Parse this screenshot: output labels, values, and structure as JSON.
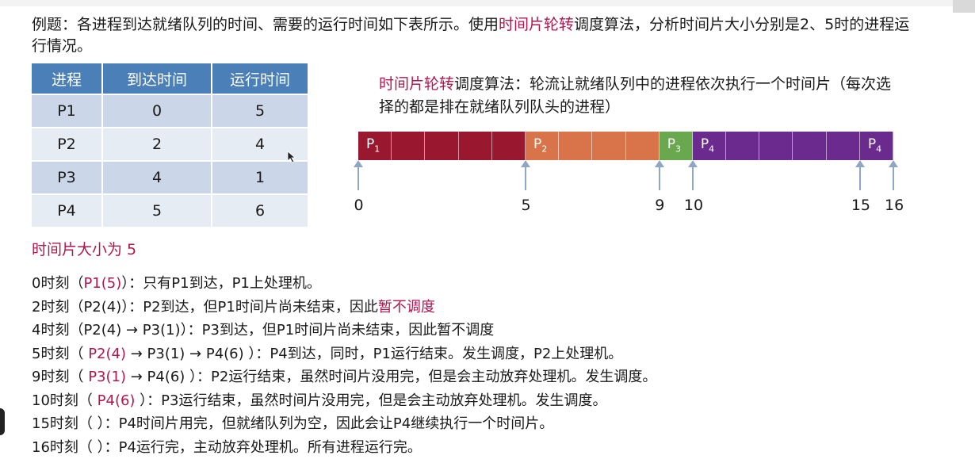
{
  "intro": {
    "part1": "例题：各进程到达就绪队列的时间、需要的运行时间如下表所示。使用",
    "highlight": "时间片轮转",
    "part2": "调度算法，分析时间片大小分别是2、5时的进程运行情况。"
  },
  "table": {
    "headers": [
      "进程",
      "到达时间",
      "运行时间"
    ],
    "rows": [
      [
        "P1",
        "0",
        "5"
      ],
      [
        "P2",
        "2",
        "4"
      ],
      [
        "P3",
        "4",
        "1"
      ],
      [
        "P4",
        "5",
        "6"
      ]
    ]
  },
  "rr_desc": {
    "highlight": "时间片轮转",
    "text": "调度算法：轮流让就绪队列中的进程依次执行一个时间片（每次选择的都是排在就绪队列队头的进程）"
  },
  "gantt": {
    "colors": {
      "P1": "#9a1730",
      "P2": "#d9744a",
      "P3": "#6aa84f",
      "P4": "#6a2a8e"
    },
    "segments": [
      {
        "label": "P",
        "sub": "1",
        "process": "P1",
        "start": 0,
        "end": 5
      },
      {
        "label": "P",
        "sub": "2",
        "process": "P2",
        "start": 5,
        "end": 9
      },
      {
        "label": "P",
        "sub": "3",
        "process": "P3",
        "start": 9,
        "end": 10
      },
      {
        "label": "P",
        "sub": "4",
        "process": "P4",
        "start": 10,
        "end": 15
      },
      {
        "label": "P",
        "sub": "4",
        "process": "P4",
        "start": 15,
        "end": 16
      }
    ],
    "ticks": [
      "0",
      "5",
      "9",
      "10",
      "15",
      "16"
    ]
  },
  "time_slice": "时间片大小为 5",
  "logs": [
    [
      {
        "t": "0时刻（"
      },
      {
        "t": "P1(5)",
        "h": true
      },
      {
        "t": "）：只有P1到达，P1上处理机。"
      }
    ],
    [
      {
        "t": "2时刻（P2(4)）：P2到达，但P1时间片尚未结束，因此"
      },
      {
        "t": "暂不调度",
        "h": true
      }
    ],
    [
      {
        "t": "4时刻（P2(4) → P3(1)）：P3到达，但P1时间片尚未结束，因此暂不调度"
      }
    ],
    [
      {
        "t": "5时刻（ "
      },
      {
        "t": "P2(4)",
        "h": true
      },
      {
        "t": " → P3(1) → P4(6) ）：P4到达，同时，P1运行结束。发生调度，P2上处理机。"
      }
    ],
    [
      {
        "t": "9时刻（ "
      },
      {
        "t": "P3(1)",
        "h": true
      },
      {
        "t": " → P4(6) ）：P2运行结束，虽然时间片没用完，但是会主动放弃处理机。发生调度。"
      }
    ],
    [
      {
        "t": "10时刻（ "
      },
      {
        "t": "P4(6)",
        "h": true
      },
      {
        "t": " ）：P3运行结束，虽然时间片没用完，但是会主动放弃处理机。发生调度。"
      }
    ],
    [
      {
        "t": "15时刻（ ）：P4时间片用完，但就绪队列为空，因此会让P4继续执行一个时间片。"
      }
    ],
    [
      {
        "t": "16时刻（ ）：P4运行完，主动放弃处理机。所有进程运行完。"
      }
    ]
  ]
}
